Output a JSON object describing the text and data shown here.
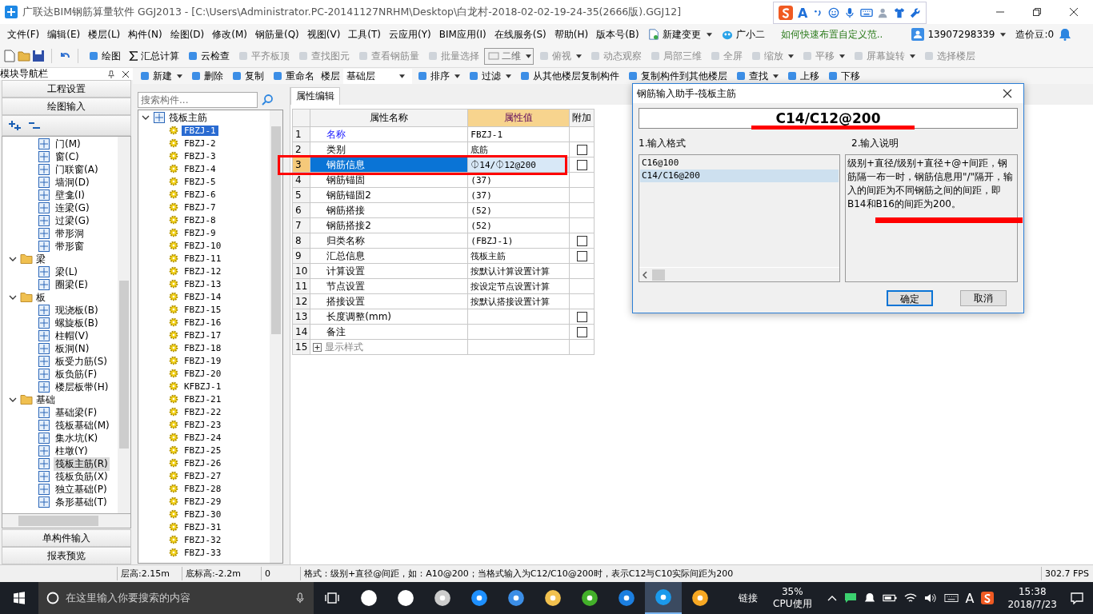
{
  "window": {
    "title": "广联达BIM钢筋算量软件 GGJ2013 - [C:\\Users\\Administrator.PC-20141127NRHM\\Desktop\\白龙村-2018-02-02-19-24-35(2666版).GGJ12]"
  },
  "ime_toolbar": {
    "label": "A"
  },
  "menu": [
    "文件(F)",
    "编辑(E)",
    "楼层(L)",
    "构件(N)",
    "绘图(D)",
    "修改(M)",
    "钢筋量(Q)",
    "视图(V)",
    "工具(T)",
    "云应用(Y)",
    "BIM应用(I)",
    "在线服务(S)",
    "帮助(H)",
    "版本号(B)"
  ],
  "menu_extras": {
    "change": "新建变更",
    "assistant": "广小二",
    "hint": "如何快速布置自定义范..",
    "account": "13907298339",
    "beans": "造价豆:0"
  },
  "toolbar": [
    {
      "label": "绘图",
      "kind": "button",
      "disabled": false
    },
    {
      "label": "汇总计算",
      "kind": "sum",
      "disabled": false
    },
    {
      "label": "云检查",
      "kind": "button",
      "disabled": false
    },
    {
      "label": "平齐板顶",
      "kind": "button",
      "disabled": true
    },
    {
      "label": "查找图元",
      "kind": "button",
      "disabled": true
    },
    {
      "label": "查看钢筋量",
      "kind": "button",
      "disabled": true
    },
    {
      "label": "批量选择",
      "kind": "button",
      "disabled": true
    },
    {
      "label": "二维",
      "kind": "select",
      "disabled": true
    },
    {
      "label": "俯视",
      "kind": "menu",
      "disabled": true
    },
    {
      "label": "动态观察",
      "kind": "button",
      "disabled": true
    },
    {
      "label": "局部三维",
      "kind": "button",
      "disabled": true
    },
    {
      "label": "全屏",
      "kind": "button",
      "disabled": true
    },
    {
      "label": "缩放",
      "kind": "menu",
      "disabled": true
    },
    {
      "label": "平移",
      "kind": "menu",
      "disabled": true
    },
    {
      "label": "屏幕旋转",
      "kind": "menu",
      "disabled": true
    },
    {
      "label": "选择楼层",
      "kind": "button",
      "disabled": true
    }
  ],
  "nav": {
    "title": "模块导航栏",
    "top_buttons": [
      "工程设置",
      "绘图输入"
    ],
    "bottom_buttons": [
      "单构件输入",
      "报表预览"
    ],
    "tree": [
      {
        "children": [
          {
            "label": "门(M)",
            "selected": false
          },
          {
            "label": "窗(C)",
            "selected": false
          },
          {
            "label": "门联窗(A)",
            "selected": false
          },
          {
            "label": "墙洞(D)",
            "selected": false
          },
          {
            "label": "壁龛(I)",
            "selected": false
          },
          {
            "label": "连梁(G)",
            "selected": false
          },
          {
            "label": "过梁(G)",
            "selected": false
          },
          {
            "label": "带形洞",
            "selected": false
          },
          {
            "label": "带形窗",
            "selected": false
          }
        ]
      },
      {
        "label": "梁",
        "expanded": true,
        "children": [
          {
            "label": "梁(L)",
            "selected": false
          },
          {
            "label": "圈梁(E)",
            "selected": false
          }
        ]
      },
      {
        "label": "板",
        "expanded": true,
        "children": [
          {
            "label": "现浇板(B)",
            "selected": false
          },
          {
            "label": "螺旋板(B)",
            "selected": false
          },
          {
            "label": "柱帽(V)",
            "selected": false
          },
          {
            "label": "板洞(N)",
            "selected": false
          },
          {
            "label": "板受力筋(S)",
            "selected": false
          },
          {
            "label": "板负筋(F)",
            "selected": false
          },
          {
            "label": "楼层板带(H)",
            "selected": false
          }
        ]
      },
      {
        "label": "基础",
        "expanded": true,
        "children": [
          {
            "label": "基础梁(F)",
            "selected": false
          },
          {
            "label": "筏板基础(M)",
            "selected": false
          },
          {
            "label": "集水坑(K)",
            "selected": false
          },
          {
            "label": "柱墩(Y)",
            "selected": false
          },
          {
            "label": "筏板主筋(R)",
            "selected": true
          },
          {
            "label": "筏板负筋(X)",
            "selected": false
          },
          {
            "label": "独立基础(P)",
            "selected": false
          },
          {
            "label": "条形基础(T)",
            "selected": false
          }
        ]
      }
    ]
  },
  "component_toolbar": [
    {
      "label": "新建",
      "kind": "menu"
    },
    {
      "label": "删除",
      "kind": "button"
    },
    {
      "label": "复制",
      "kind": "button"
    },
    {
      "label": "重命名",
      "kind": "button"
    },
    {
      "label": "楼层",
      "kind": "label"
    },
    {
      "label": "基础层",
      "kind": "select"
    },
    {
      "label": "排序",
      "kind": "menu"
    },
    {
      "label": "过滤",
      "kind": "menu"
    },
    {
      "label": "从其他楼层复制构件",
      "kind": "button"
    },
    {
      "label": "复制构件到其他楼层",
      "kind": "button"
    },
    {
      "label": "查找",
      "kind": "menu"
    },
    {
      "label": "上移",
      "kind": "button"
    },
    {
      "label": "下移",
      "kind": "button"
    }
  ],
  "components": {
    "search": {
      "placeholder": "搜索构件..."
    },
    "tree": {
      "label": "筏板主筋",
      "expanded": true,
      "children": [
        {
          "label": "FBZJ-1",
          "selected": true
        },
        {
          "label": "FBZJ-2",
          "selected": false
        },
        {
          "label": "FBZJ-3",
          "selected": false
        },
        {
          "label": "FBZJ-4",
          "selected": false
        },
        {
          "label": "FBZJ-5",
          "selected": false
        },
        {
          "label": "FBZJ-6",
          "selected": false
        },
        {
          "label": "FBZJ-7",
          "selected": false
        },
        {
          "label": "FBZJ-8",
          "selected": false
        },
        {
          "label": "FBZJ-9",
          "selected": false
        },
        {
          "label": "FBZJ-10",
          "selected": false
        },
        {
          "label": "FBZJ-11",
          "selected": false
        },
        {
          "label": "FBZJ-12",
          "selected": false
        },
        {
          "label": "FBZJ-13",
          "selected": false
        },
        {
          "label": "FBZJ-14",
          "selected": false
        },
        {
          "label": "FBZJ-15",
          "selected": false
        },
        {
          "label": "FBZJ-16",
          "selected": false
        },
        {
          "label": "FBZJ-17",
          "selected": false
        },
        {
          "label": "FBZJ-18",
          "selected": false
        },
        {
          "label": "FBZJ-19",
          "selected": false
        },
        {
          "label": "FBZJ-20",
          "selected": false
        },
        {
          "label": "KFBZJ-1",
          "selected": false
        },
        {
          "label": "FBZJ-21",
          "selected": false
        },
        {
          "label": "FBZJ-22",
          "selected": false
        },
        {
          "label": "FBZJ-23",
          "selected": false
        },
        {
          "label": "FBZJ-24",
          "selected": false
        },
        {
          "label": "FBZJ-25",
          "selected": false
        },
        {
          "label": "FBZJ-26",
          "selected": false
        },
        {
          "label": "FBZJ-27",
          "selected": false
        },
        {
          "label": "FBZJ-28",
          "selected": false
        },
        {
          "label": "FBZJ-29",
          "selected": false
        },
        {
          "label": "FBZJ-30",
          "selected": false
        },
        {
          "label": "FBZJ-31",
          "selected": false
        },
        {
          "label": "FBZJ-32",
          "selected": false
        },
        {
          "label": "FBZJ-33",
          "selected": false
        }
      ]
    }
  },
  "properties": {
    "tab": "属性编辑",
    "columns": [
      "属性名称",
      "属性值",
      "附加"
    ],
    "rows": [
      {
        "index": "1",
        "name": "名称",
        "value": "FBZJ-1",
        "kind": "link",
        "selected": false
      },
      {
        "index": "2",
        "name": "类别",
        "value": "底筋",
        "kind": "plain",
        "selected": false,
        "checkbox": {
          "checked": false
        }
      },
      {
        "index": "3",
        "name": "钢筋信息",
        "value": "⏀14/⏀12@200",
        "kind": "plain",
        "selected": true,
        "checkbox": {
          "checked": false
        }
      },
      {
        "index": "4",
        "name": "钢筋锚固",
        "value": "(37)",
        "kind": "plain",
        "selected": false
      },
      {
        "index": "5",
        "name": "钢筋锚固2",
        "value": "(37)",
        "kind": "plain",
        "selected": false
      },
      {
        "index": "6",
        "name": "钢筋搭接",
        "value": "(52)",
        "kind": "plain",
        "selected": false
      },
      {
        "index": "7",
        "name": "钢筋搭接2",
        "value": "(52)",
        "kind": "plain",
        "selected": false
      },
      {
        "index": "8",
        "name": "归类名称",
        "value": "(FBZJ-1)",
        "kind": "plain",
        "selected": false,
        "checkbox": {
          "checked": false
        }
      },
      {
        "index": "9",
        "name": "汇总信息",
        "value": "筏板主筋",
        "kind": "plain",
        "selected": false,
        "checkbox": {
          "checked": false
        }
      },
      {
        "index": "10",
        "name": "计算设置",
        "value": "按默认计算设置计算",
        "kind": "plain",
        "selected": false
      },
      {
        "index": "11",
        "name": "节点设置",
        "value": "按设定节点设置计算",
        "kind": "plain",
        "selected": false
      },
      {
        "index": "12",
        "name": "搭接设置",
        "value": "按默认搭接设置计算",
        "kind": "plain",
        "selected": false
      },
      {
        "index": "13",
        "name": "长度调整(mm)",
        "kind": "plain",
        "selected": false,
        "checkbox": {
          "checked": false
        }
      },
      {
        "index": "14",
        "name": "备注",
        "kind": "plain",
        "selected": false,
        "checkbox": {
          "checked": false
        }
      },
      {
        "index": "15",
        "name": "显示样式",
        "kind": "group",
        "expanded": false,
        "selected": false
      }
    ]
  },
  "dialog": {
    "title": "钢筋输入助手-筏板主筋",
    "value": "C14/C12@200",
    "format_label": "1.输入格式",
    "formats": [
      {
        "label": "C16@100",
        "selected": false
      },
      {
        "label": "C14/C16@200",
        "selected": true
      }
    ],
    "help_label": "2.输入说明",
    "help": "级别+直径/级别+直径+@+间距，钢筋隔一布一时，钢筋信息用\"/\"隔开，输入的间距为不同钢筋之间的间距，即B14和B16的间距为200。",
    "buttons": [
      {
        "label": "确定",
        "kind": "default"
      },
      {
        "label": "取消",
        "kind": "normal"
      }
    ]
  },
  "status_bar": [
    "层高:2.15m",
    "底标高:-2.2m",
    "0",
    "格式：级别+直径@间距，如：A10@200；当格式输入为C12/C10@200时，表示C12与C10实际间距为200",
    "302.7 FPS"
  ],
  "taskbar": {
    "search": {
      "placeholder": "在这里输入你要搜索的内容"
    },
    "apps": [
      {
        "color": "#ffffff",
        "selected": false
      },
      {
        "color": "#ffffff",
        "selected": false
      },
      {
        "color": "#cccccc",
        "selected": false
      },
      {
        "color": "#1e90ff",
        "selected": false
      },
      {
        "color": "#3c8ee6",
        "selected": false
      },
      {
        "color": "#f2c14e",
        "selected": false
      },
      {
        "color": "#43b02a",
        "selected": false
      },
      {
        "color": "#1c7fe0",
        "selected": false
      },
      {
        "color": "#1b9aec",
        "selected": true
      },
      {
        "color": "#f7a823",
        "selected": false
      }
    ],
    "link": "链接",
    "cpu": "35%",
    "cpu_label": "CPU使用",
    "ime": "A",
    "time": "15:38",
    "date": "2018/7/23"
  }
}
